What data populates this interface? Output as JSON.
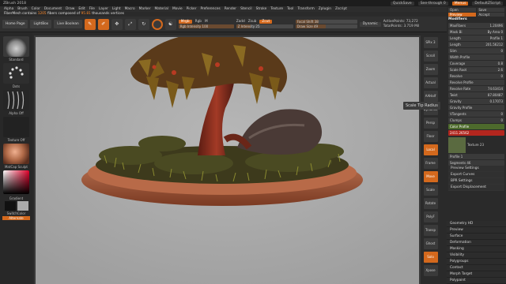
{
  "titlebar": {
    "app": "ZBrush 2018",
    "quicksave": "QuickSave",
    "seethrough": "See-through",
    "seethrough_val": "0",
    "menus": "Menus",
    "script": "DefaultZScript"
  },
  "menubar": [
    "Alpha",
    "Brush",
    "Color",
    "Document",
    "Draw",
    "Edit",
    "File",
    "Layer",
    "Light",
    "Macro",
    "Marker",
    "Material",
    "Movie",
    "Picker",
    "Preferences",
    "Render",
    "Stencil",
    "Stroke",
    "Texture",
    "Tool",
    "Transform",
    "Zplugin",
    "Zscript"
  ],
  "note": {
    "prefix": "FiberMesh contains ",
    "count": "1205",
    "suffix": " fibers composed of ",
    "verts": "95.81",
    "tail": " thousands vertices"
  },
  "toolbar": {
    "home": "Home Page",
    "lightbox": "LightBox",
    "liveboolean": "Live Boolean",
    "edit": "Edit",
    "draw": "Draw",
    "move": "Move",
    "scale": "Scale",
    "rotate": "Rotate",
    "mrgb": "Mrgb",
    "rgb": "Rgb",
    "m": "M",
    "rgb_intensity": "Rgb Intensity 100",
    "zadd": "Zadd",
    "zsub": "Zsub",
    "zcut": "Zcut",
    "z_intensity": "Z Intensity 25",
    "focal_shift": "Focal Shift 38",
    "draw_size": "Draw Size 49",
    "dynamic": "Dynamic",
    "active_points": "ActivePoints: 73,272",
    "total_points": "TotalPoints: 3.719 Mil",
    "rgb_fill": 1.0,
    "z_fill": 0.25,
    "focal_fill": 0.38,
    "draw_fill": 0.49
  },
  "lefttray": {
    "standard": "Standard",
    "dots": "Dots",
    "alpha_off": "Alpha Off",
    "texture_off": "Texture Off",
    "matcap": "MatCap Sculpt",
    "gradient": "Gradient",
    "switchcolor": "SwitchColor",
    "alternate": "Alternate"
  },
  "rightshelf": [
    "SPix 3",
    "Scroll",
    "Zoom",
    "Actual",
    "AAHalf",
    "Dynamic",
    "Persp",
    "Floor",
    "Local",
    "Frame",
    "Move",
    "Scale",
    "Rotate",
    "PolyF",
    "Transp",
    "Ghost",
    "Solo",
    "Xpose"
  ],
  "tooltip": "Scale Tip Radius",
  "rightpanel": {
    "open": "Open",
    "save": "Save",
    "preview": "Preview",
    "accept": "Accept",
    "modifiers": "Modifiers",
    "rows": [
      {
        "k": "MaxFibers",
        "v": "1.20496"
      },
      {
        "k": "Mask Bi",
        "v": "By Area 0"
      },
      {
        "k": "Length",
        "v": "Profile 1"
      },
      {
        "k": "Length",
        "v": "201.56212"
      },
      {
        "k": "Slim",
        "v": "0"
      },
      {
        "k": "Width Profile",
        "v": ""
      },
      {
        "k": "Coverage",
        "v": "0.8"
      },
      {
        "k": "Scale Root",
        "v": "2.6"
      },
      {
        "k": "Revolve",
        "v": "0"
      },
      {
        "k": "Revolve Profile",
        "v": ""
      },
      {
        "k": "Revolve Rate",
        "v": "74.63414"
      },
      {
        "k": "Twist",
        "v": "87.80487"
      },
      {
        "k": "Gravity",
        "v": "0.17073"
      },
      {
        "k": "Gravity Profile",
        "v": ""
      },
      {
        "k": "VTangents",
        "v": "0"
      },
      {
        "k": "Clumps",
        "v": "0"
      },
      {
        "k": "Color Profile",
        "v": ""
      }
    ],
    "red_val": "2411.26562",
    "texture": "Texture 23",
    "profile": "Profile 1",
    "segments": "Segments 46",
    "items": [
      "Preview Settings",
      "Export Curves",
      "BPR Settings",
      "Export Displacement"
    ]
  },
  "bottomlist": [
    "Geometry HD",
    "Preview",
    "Surface",
    "Deformation",
    "Masking",
    "Visibility",
    "Polygroups",
    "Contact",
    "Morph Target",
    "Polypaint"
  ]
}
